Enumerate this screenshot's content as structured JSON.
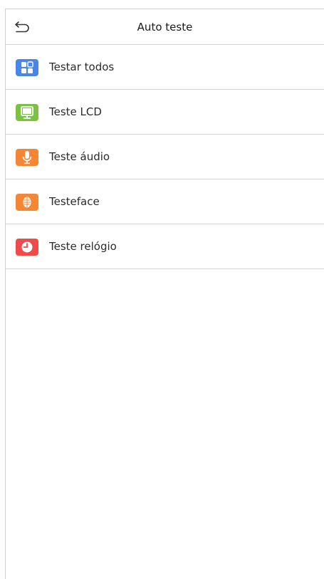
{
  "header": {
    "back_icon": "back-arrow-icon",
    "title": "Auto teste"
  },
  "items": [
    {
      "label": "Testar todos",
      "icon": "grid-apps-icon",
      "color": "#4a86e8"
    },
    {
      "label": "Teste LCD",
      "icon": "monitor-icon",
      "color": "#7cc242"
    },
    {
      "label": "Teste áudio",
      "icon": "microphone-icon",
      "color": "#f58634"
    },
    {
      "label": "Testeface",
      "icon": "face-scan-icon",
      "color": "#f58634"
    },
    {
      "label": "Teste relógio",
      "icon": "clock-icon",
      "color": "#ef4b4b"
    }
  ]
}
